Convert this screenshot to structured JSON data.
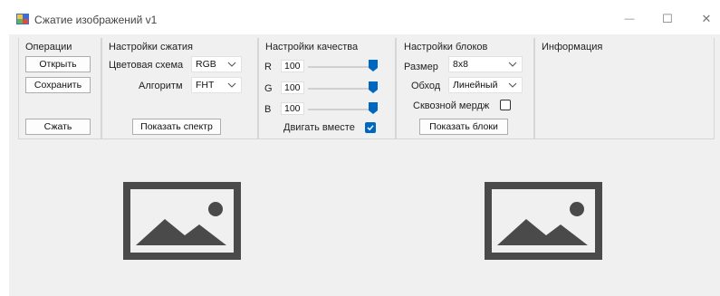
{
  "window": {
    "title": "Сжатие изображений v1",
    "controls": {
      "minimize": "—",
      "maximize": "☐",
      "close": "✕"
    }
  },
  "operations": {
    "title": "Операции",
    "open_label": "Открыть",
    "save_label": "Сохранить",
    "compress_label": "Сжать"
  },
  "compression": {
    "title": "Настройки сжатия",
    "color_scheme_label": "Цветовая схема",
    "color_scheme_value": "RGB",
    "algorithm_label": "Алгоритм",
    "algorithm_value": "FHT",
    "show_spectrum_label": "Показать спектр"
  },
  "quality": {
    "title": "Настройки качества",
    "channels": [
      {
        "name": "R",
        "value": "100",
        "level": 1.0
      },
      {
        "name": "G",
        "value": "100",
        "level": 1.0
      },
      {
        "name": "B",
        "value": "100",
        "level": 1.0
      }
    ],
    "move_together_label": "Двигать вместе",
    "move_together_checked": true
  },
  "blocks": {
    "title": "Настройки блоков",
    "size_label": "Размер",
    "size_value": "8x8",
    "traversal_label": "Обход",
    "traversal_value": "Линейный",
    "through_merge_label": "Сквозной мердж",
    "through_merge_checked": false,
    "show_blocks_label": "Показать блоки"
  },
  "info": {
    "title": "Информация"
  },
  "colors": {
    "accent": "#0067c0",
    "placeholder_icon": "#4a4a4a"
  },
  "icons": {
    "app": "app-image-icon",
    "image_placeholder": "image-placeholder-icon"
  }
}
